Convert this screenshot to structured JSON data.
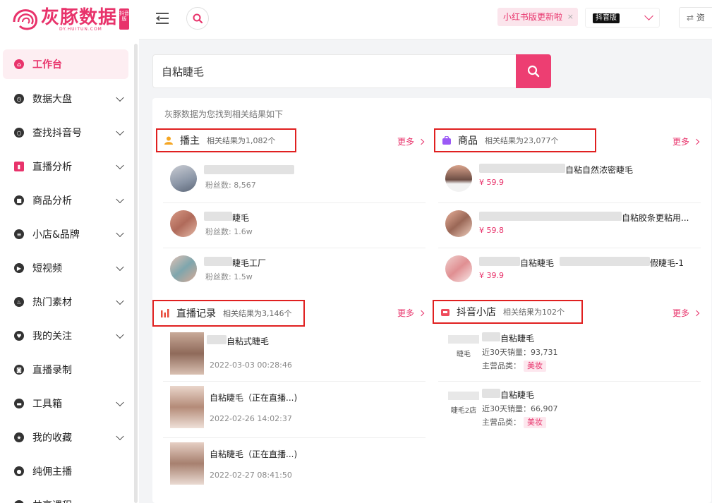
{
  "logo": {
    "text": "灰豚数据",
    "url": "DY.HUITUN.COM",
    "badge": "抖音版"
  },
  "sidebar": {
    "items": [
      {
        "label": "工作台",
        "icon": "home-icon",
        "active": true,
        "expandable": false
      },
      {
        "label": "数据大盘",
        "icon": "dashboard-icon",
        "active": false,
        "expandable": true
      },
      {
        "label": "查找抖音号",
        "icon": "search-account-icon",
        "active": false,
        "expandable": true
      },
      {
        "label": "直播分析",
        "icon": "bar-chart-icon",
        "active": false,
        "expandable": true
      },
      {
        "label": "商品分析",
        "icon": "goods-icon",
        "active": false,
        "expandable": true
      },
      {
        "label": "小店&品牌",
        "icon": "shop-icon",
        "active": false,
        "expandable": true
      },
      {
        "label": "短视频",
        "icon": "video-icon",
        "active": false,
        "expandable": true
      },
      {
        "label": "热门素材",
        "icon": "fire-icon",
        "active": false,
        "expandable": true
      },
      {
        "label": "我的关注",
        "icon": "follow-icon",
        "active": false,
        "expandable": true
      },
      {
        "label": "直播录制",
        "icon": "camera-icon",
        "active": false,
        "expandable": false
      },
      {
        "label": "工具箱",
        "icon": "toolbox-icon",
        "active": false,
        "expandable": true
      },
      {
        "label": "我的收藏",
        "icon": "star-icon",
        "active": false,
        "expandable": true
      },
      {
        "label": "纯佣主播",
        "icon": "anchor-icon",
        "active": false,
        "expandable": false
      },
      {
        "label": "共享课程",
        "icon": "course-icon",
        "active": false,
        "expandable": false
      }
    ]
  },
  "topbar": {
    "notice": "小红书版更新啦",
    "notice_close": "×",
    "version_tag": "抖音版",
    "resource_label": "资"
  },
  "search": {
    "query": "自粘睫毛"
  },
  "results": {
    "found_text": "灰豚数据为您找到相关结果如下",
    "more_label": "更多",
    "anchors": {
      "title": "播主",
      "count": "相关结果为1,082个",
      "rows": [
        {
          "name": "",
          "sub": "粉丝数: 8,567"
        },
        {
          "name": "睫毛",
          "sub": "粉丝数: 1.6w"
        },
        {
          "name": "睫毛工厂",
          "sub": "粉丝数: 1.5w"
        }
      ]
    },
    "goods": {
      "title": "商品",
      "count": "相关结果为23,077个",
      "rows": [
        {
          "name": "自粘自然浓密睫毛",
          "price": "¥ 59.9"
        },
        {
          "name": "自粘胶条更粘用...",
          "price": "¥ 59.8"
        },
        {
          "name": "自粘睫毛",
          "name2": "假睫毛-1",
          "price": "¥ 39.9"
        }
      ]
    },
    "live": {
      "title": "直播记录",
      "count": "相关结果为3,146个",
      "rows": [
        {
          "name": "自粘式睫毛",
          "time": "2022-03-03 00:28:46"
        },
        {
          "name": "自粘睫毛（正在直播...)",
          "time": "2022-02-26 14:02:37"
        },
        {
          "name": "自粘睫毛（正在直播...)",
          "time": "2022-02-27 08:41:50"
        }
      ]
    },
    "shops": {
      "title": "抖音小店",
      "count": "相关结果为102个",
      "rows": [
        {
          "logo_text": "睫毛",
          "name": "自粘睫毛",
          "sales": "近30天销量：93,731",
          "category_label": "主营品类：",
          "category": "美妆"
        },
        {
          "logo_text": "睫毛2店",
          "name": "自粘睫毛",
          "sales": "近30天销量：66,907",
          "category_label": "主营品类：",
          "category": "美妆"
        }
      ]
    }
  },
  "colors": {
    "accent": "#e8336b",
    "highlight_border": "#e02020"
  }
}
